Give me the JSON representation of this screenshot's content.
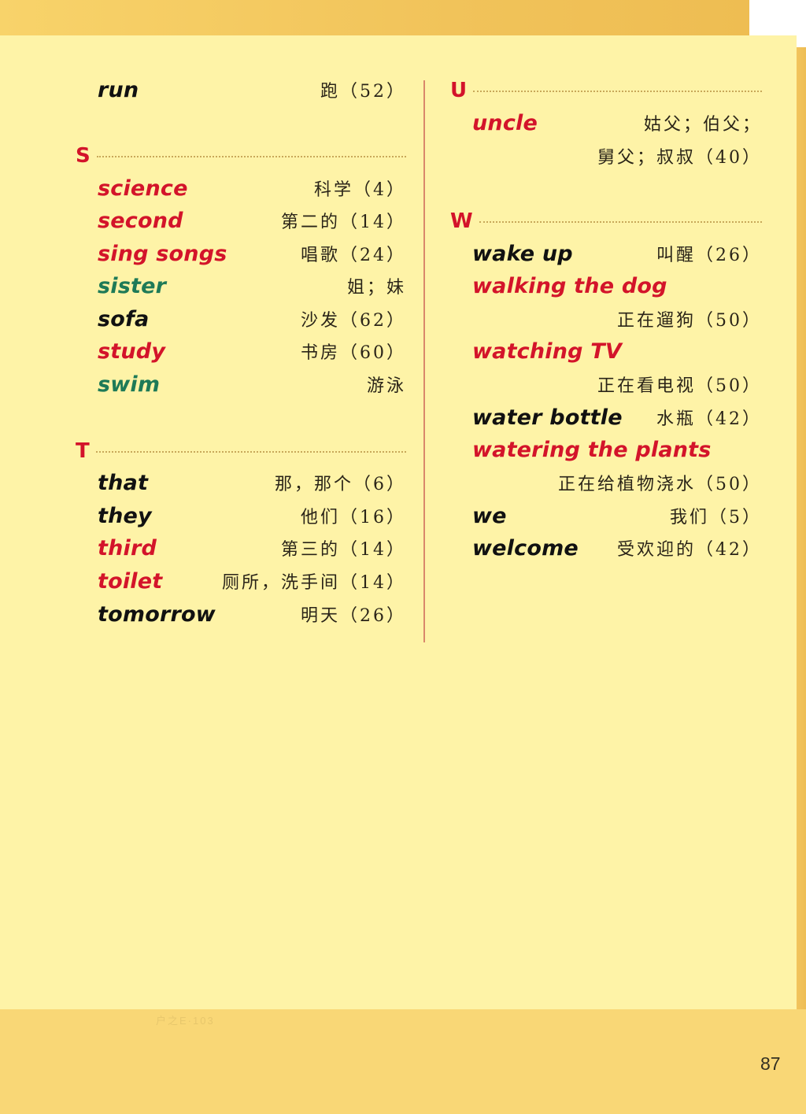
{
  "page": {
    "page_number": "87",
    "faint_mark": "户之E·103"
  },
  "colors": {
    "red": "#d3142a",
    "green": "#1e7a57",
    "black": "#111111",
    "paper": "#fef3a7",
    "border": "#f9d776"
  },
  "left_column": {
    "run": {
      "word": "run",
      "meaning": "跑（52）",
      "color": "black"
    },
    "sections": [
      {
        "letter": "S",
        "entries": [
          {
            "word": "science",
            "meaning": "科学（4）",
            "color": "red"
          },
          {
            "word": "second",
            "meaning": "第二的（14）",
            "color": "red"
          },
          {
            "word": "sing songs",
            "meaning": "唱歌（24）",
            "color": "red"
          },
          {
            "word": "sister",
            "meaning": "姐；妹",
            "color": "green"
          },
          {
            "word": "sofa",
            "meaning": "沙发（62）",
            "color": "black"
          },
          {
            "word": "study",
            "meaning": "书房（60）",
            "color": "red"
          },
          {
            "word": "swim",
            "meaning": "游泳",
            "color": "green"
          }
        ]
      },
      {
        "letter": "T",
        "entries": [
          {
            "word": "that",
            "meaning": "那，那个（6）",
            "color": "black"
          },
          {
            "word": "they",
            "meaning": "他们（16）",
            "color": "black"
          },
          {
            "word": "third",
            "meaning": "第三的（14）",
            "color": "red"
          },
          {
            "word": "toilet",
            "meaning": "厕所，洗手间（14）",
            "color": "red"
          },
          {
            "word": "tomorrow",
            "meaning": "明天（26）",
            "color": "black"
          }
        ]
      }
    ]
  },
  "right_column": {
    "sections": [
      {
        "letter": "U",
        "entries": [
          {
            "word": "uncle",
            "meaning": "姑父；伯父；",
            "meaning_line2": "舅父；叔叔（40）",
            "color": "red"
          }
        ]
      },
      {
        "letter": "W",
        "entries": [
          {
            "word": "wake up",
            "meaning": "叫醒（26）",
            "color": "black"
          },
          {
            "word": "walking the dog",
            "meaning_line2": "正在遛狗（50）",
            "color": "red"
          },
          {
            "word": "watching TV",
            "meaning_line2": "正在看电视（50）",
            "color": "red"
          },
          {
            "word": "water bottle",
            "meaning": "水瓶（42）",
            "color": "black"
          },
          {
            "word": "watering the plants",
            "meaning_line2": "正在给植物浇水（50）",
            "color": "red"
          },
          {
            "word": "we",
            "meaning": "我们（5）",
            "color": "black"
          },
          {
            "word": "welcome",
            "meaning": "受欢迎的（42）",
            "color": "black"
          }
        ]
      }
    ]
  }
}
